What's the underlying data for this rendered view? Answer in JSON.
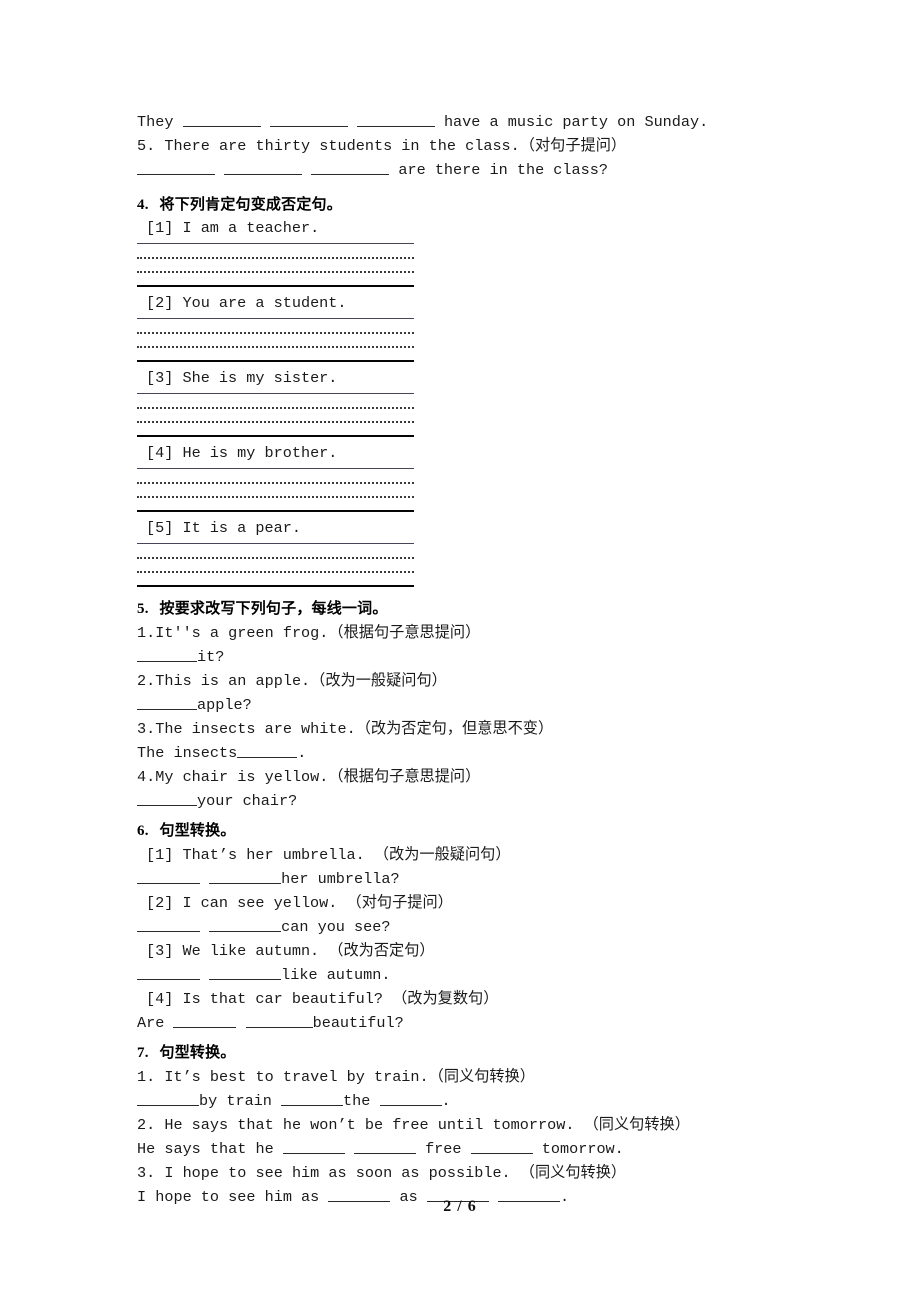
{
  "document": {
    "page_label": "2 / 6"
  },
  "top_fragment": {
    "line1_pre": "They ",
    "line1_post": " have a music party on Sunday.",
    "line2": "5. There are thirty students in the class.（对句子提问）",
    "line3_post": " are there in the class?"
  },
  "section4": {
    "heading_num": "4.",
    "heading_text": "将下列肯定句变成否定句。",
    "items": [
      {
        "label": "[1]",
        "text": "I am a teacher."
      },
      {
        "label": "[2]",
        "text": "You are a student."
      },
      {
        "label": "[3]",
        "text": "She is my sister."
      },
      {
        "label": "[4]",
        "text": "He is my brother."
      },
      {
        "label": "[5]",
        "text": "It is a pear."
      }
    ]
  },
  "section5": {
    "heading_num": "5.",
    "heading_text": "按要求改写下列句子，每线一词。",
    "q1": "1.It''s a green frog.（根据句子意思提问）",
    "a1_post": "it?",
    "q2": "2.This is an apple.（改为一般疑问句）",
    "a2_post": "apple?",
    "q3": "3.The insects are white.（改为否定句，但意思不变）",
    "a3_pre": "The insects",
    "a3_post": ".",
    "q4": "4.My chair is yellow.（根据句子意思提问）",
    "a4_post": "your chair?"
  },
  "section6": {
    "heading_num": "6.",
    "heading_text": "句型转换。",
    "q1": "[1] That’s her umbrella. （改为一般疑问句）",
    "a1_post": "her umbrella?",
    "q2": "[2] I can see yellow. （对句子提问）",
    "a2_post": "can you see?",
    "q3": "[3] We like autumn. （改为否定句）",
    "a3_post": "like autumn.",
    "q4": "[4] Is that car beautiful? （改为复数句）",
    "a4_pre": "Are ",
    "a4_post": "beautiful?"
  },
  "section7": {
    "heading_num": "7.",
    "heading_text": "句型转换。",
    "q1": "1. It’s best to travel by train.（同义句转换）",
    "a1_mid1": "by train ",
    "a1_mid2": "the ",
    "a1_end": ".",
    "q2": "2. He says that he won’t be free until tomorrow. （同义句转换）",
    "a2_pre": "He says that he ",
    "a2_mid": " free ",
    "a2_end": " tomorrow.",
    "q3": "3. I hope to see him as soon as possible. （同义句转换）",
    "a3_pre": "I hope to see him as ",
    "a3_mid": " as ",
    "a3_end": "."
  }
}
